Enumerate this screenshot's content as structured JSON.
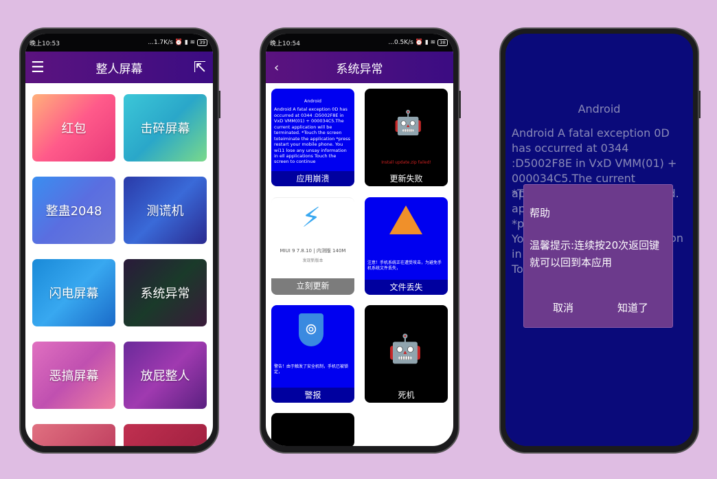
{
  "phone1": {
    "status": {
      "time": "晚上10:53",
      "speed": "...1.7K/s",
      "battery": "39"
    },
    "title": "整人屏幕",
    "tiles": [
      {
        "label": "红包"
      },
      {
        "label": "击碎屏幕"
      },
      {
        "label": "整蛊2048"
      },
      {
        "label": "测谎机"
      },
      {
        "label": "闪电屏幕"
      },
      {
        "label": "系统异常"
      },
      {
        "label": "恶搞屏幕"
      },
      {
        "label": "放屁整人"
      }
    ]
  },
  "phone2": {
    "status": {
      "time": "晚上10:54",
      "speed": "...0.5K/s",
      "battery": "38"
    },
    "title": "系统异常",
    "tiles": [
      {
        "label": "应用崩溃",
        "preview_title": "Android",
        "preview_text": "Android A fatal exception 0D has occurred at 0344 :D5002F8E in VxD VMM(01) + 000034C5.The current application will be terminated. *Touch the screen toteiminate the application *press restart your mobile phone. You wi11 lose any unsay information in ell applications Touch the screen to continue"
      },
      {
        "label": "更新失败",
        "preview_text": "Install update.zip failed!"
      },
      {
        "label": "立刻更新",
        "preview_text": "MIUI 9 7.8.10 | 内测版 140M",
        "preview_sub": "发现新版本"
      },
      {
        "label": "文件丢失",
        "preview_text": "注意！手机系统正在遭受攻击，为避免手机系统文件丢失，"
      },
      {
        "label": "警报",
        "preview_text": "警告！由于触发了安全机制，手机已被锁定，"
      },
      {
        "label": "死机"
      }
    ]
  },
  "phone3": {
    "bg_title": "Android",
    "bg_text": "Android A fatal exception 0D has occurred at 0344 :D5002F8E in VxD VMM(01) + 000034C5.The current application will be terminated.",
    "bg_fragments": [
      "*T",
      "app",
      "*p",
      "Yo",
      "on",
      "in e",
      "To"
    ],
    "dialog": {
      "title": "帮助",
      "message": "温馨提示:连续按20次返回键就可以回到本应用",
      "cancel": "取消",
      "ok": "知道了"
    }
  },
  "colors": {
    "background": "#dfbde3",
    "header": "#4a1080",
    "crash_blue": "#0000f0",
    "dialog": "#6c3a8c",
    "phone3_bg": "#0a0a7a"
  }
}
